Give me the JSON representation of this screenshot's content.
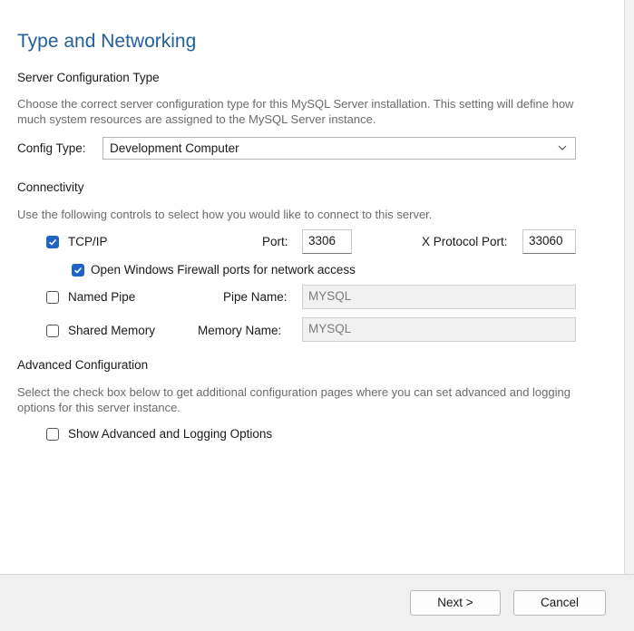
{
  "title": "Type and Networking",
  "server_config": {
    "heading": "Server Configuration Type",
    "description": "Choose the correct server configuration type for this MySQL Server installation. This setting will define how much system resources are assigned to the MySQL Server instance.",
    "config_type_label": "Config Type:",
    "config_type_value": "Development Computer"
  },
  "connectivity": {
    "heading": "Connectivity",
    "description": "Use the following controls to select how you would like to connect to this server.",
    "tcpip": {
      "label": "TCP/IP",
      "checked": true
    },
    "port_label": "Port:",
    "port_value": "3306",
    "x_port_label": "X Protocol Port:",
    "x_port_value": "33060",
    "firewall": {
      "label": "Open Windows Firewall ports for network access",
      "checked": true
    },
    "named_pipe": {
      "label": "Named Pipe",
      "checked": false
    },
    "pipe_name_label": "Pipe Name:",
    "pipe_name_value": "MYSQL",
    "shared_memory": {
      "label": "Shared Memory",
      "checked": false
    },
    "memory_name_label": "Memory Name:",
    "memory_name_value": "MYSQL"
  },
  "advanced": {
    "heading": "Advanced Configuration",
    "description": "Select the check box below to get additional configuration pages where you can set advanced and logging options for this server instance.",
    "show_advanced": {
      "label": "Show Advanced and Logging Options",
      "checked": false
    }
  },
  "footer": {
    "next_label": "Next >",
    "cancel_label": "Cancel"
  },
  "colors": {
    "title": "#23609c",
    "checkbox_accent": "#1f63c6",
    "footer_bg": "#f0f0f0"
  },
  "icons": {
    "chevron": "chevron-down-icon",
    "check": "checkmark-icon"
  }
}
